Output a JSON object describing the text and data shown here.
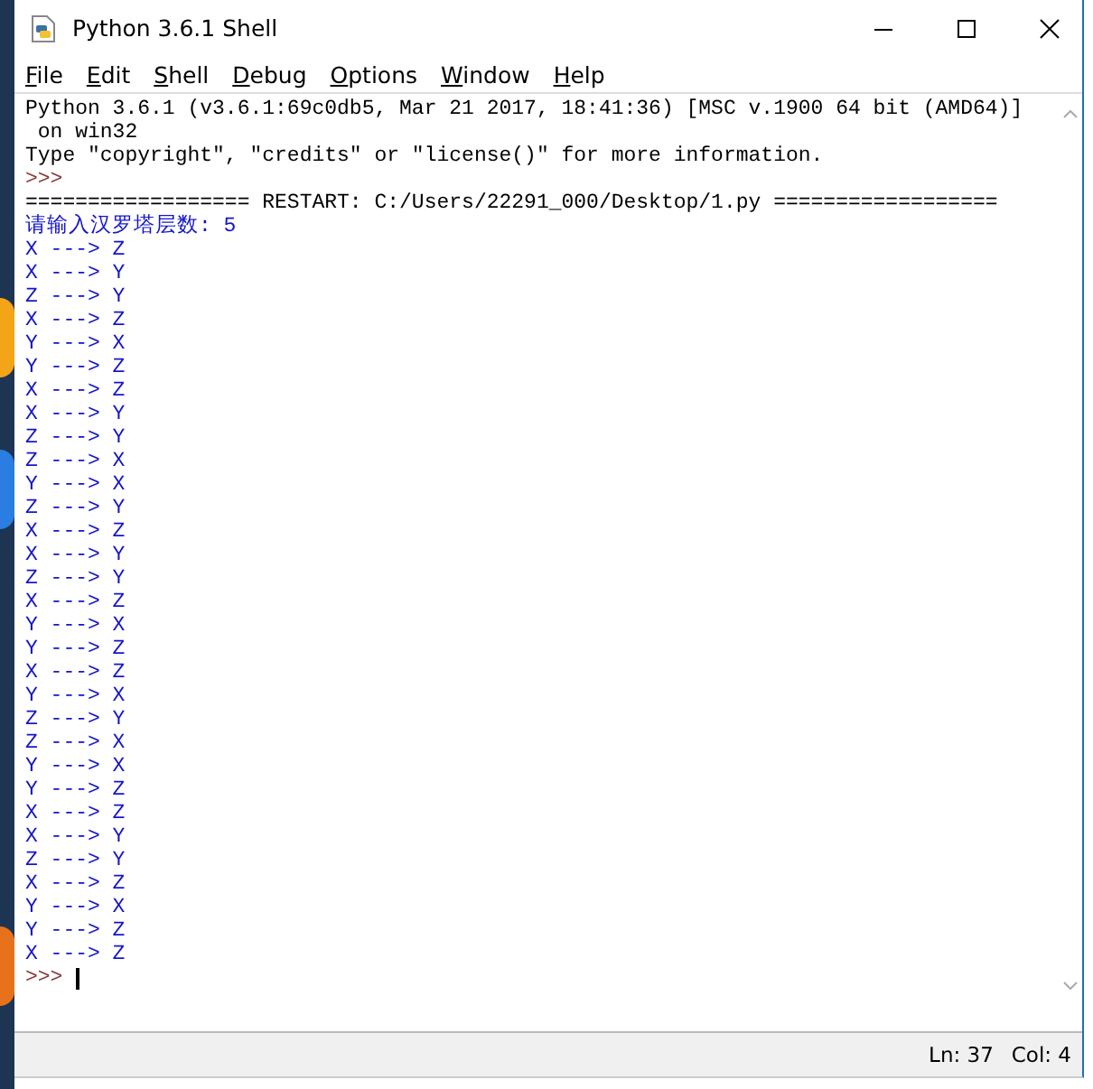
{
  "window": {
    "title": "Python 3.6.1 Shell"
  },
  "menu": [
    {
      "label": "File"
    },
    {
      "label": "Edit"
    },
    {
      "label": "Shell"
    },
    {
      "label": "Debug"
    },
    {
      "label": "Options"
    },
    {
      "label": "Window"
    },
    {
      "label": "Help"
    }
  ],
  "shell_lines": [
    {
      "kind": "output",
      "text": "Python 3.6.1 (v3.6.1:69c0db5, Mar 21 2017, 18:41:36) [MSC v.1900 64 bit (AMD64)]"
    },
    {
      "kind": "output",
      "text": " on win32"
    },
    {
      "kind": "output",
      "text": "Type \"copyright\", \"credits\" or \"license()\" for more information."
    },
    {
      "kind": "prompt",
      "text": ">>>"
    },
    {
      "kind": "output",
      "text": "================== RESTART: C:/Users/22291_000/Desktop/1.py =================="
    },
    {
      "kind": "stdout",
      "text": "请输入汉罗塔层数: 5"
    },
    {
      "kind": "stdout",
      "text": "X ---> Z"
    },
    {
      "kind": "stdout",
      "text": "X ---> Y"
    },
    {
      "kind": "stdout",
      "text": "Z ---> Y"
    },
    {
      "kind": "stdout",
      "text": "X ---> Z"
    },
    {
      "kind": "stdout",
      "text": "Y ---> X"
    },
    {
      "kind": "stdout",
      "text": "Y ---> Z"
    },
    {
      "kind": "stdout",
      "text": "X ---> Z"
    },
    {
      "kind": "stdout",
      "text": "X ---> Y"
    },
    {
      "kind": "stdout",
      "text": "Z ---> Y"
    },
    {
      "kind": "stdout",
      "text": "Z ---> X"
    },
    {
      "kind": "stdout",
      "text": "Y ---> X"
    },
    {
      "kind": "stdout",
      "text": "Z ---> Y"
    },
    {
      "kind": "stdout",
      "text": "X ---> Z"
    },
    {
      "kind": "stdout",
      "text": "X ---> Y"
    },
    {
      "kind": "stdout",
      "text": "Z ---> Y"
    },
    {
      "kind": "stdout",
      "text": "X ---> Z"
    },
    {
      "kind": "stdout",
      "text": "Y ---> X"
    },
    {
      "kind": "stdout",
      "text": "Y ---> Z"
    },
    {
      "kind": "stdout",
      "text": "X ---> Z"
    },
    {
      "kind": "stdout",
      "text": "Y ---> X"
    },
    {
      "kind": "stdout",
      "text": "Z ---> Y"
    },
    {
      "kind": "stdout",
      "text": "Z ---> X"
    },
    {
      "kind": "stdout",
      "text": "Y ---> X"
    },
    {
      "kind": "stdout",
      "text": "Y ---> Z"
    },
    {
      "kind": "stdout",
      "text": "X ---> Z"
    },
    {
      "kind": "stdout",
      "text": "X ---> Y"
    },
    {
      "kind": "stdout",
      "text": "Z ---> Y"
    },
    {
      "kind": "stdout",
      "text": "X ---> Z"
    },
    {
      "kind": "stdout",
      "text": "Y ---> X"
    },
    {
      "kind": "stdout",
      "text": "Y ---> Z"
    },
    {
      "kind": "stdout",
      "text": "X ---> Z"
    },
    {
      "kind": "input_prompt",
      "text": ">>>"
    }
  ],
  "status_bar": {
    "line": "Ln: 37",
    "column": "Col: 4"
  }
}
